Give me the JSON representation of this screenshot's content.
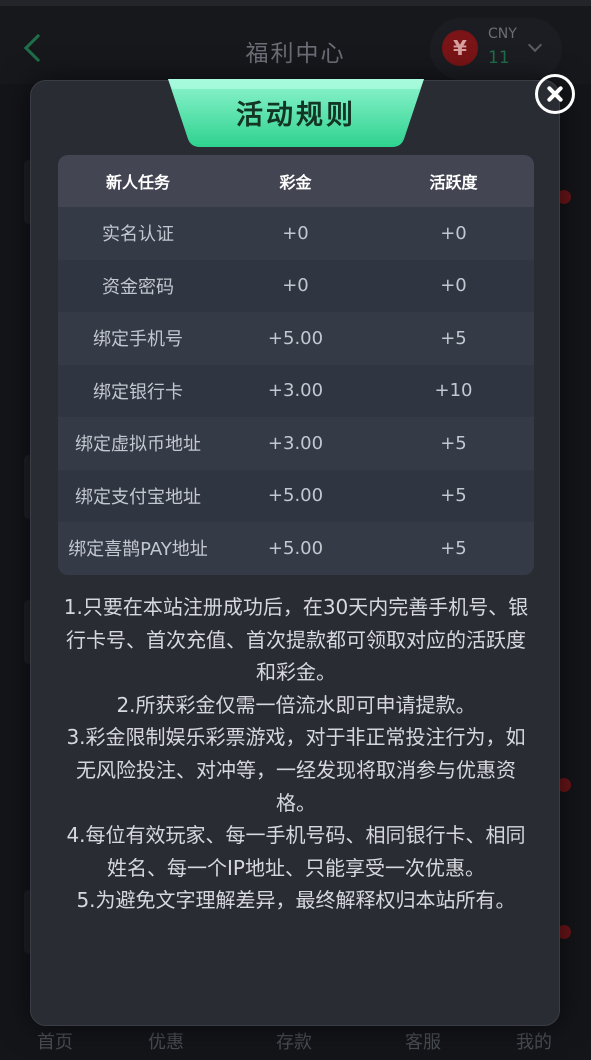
{
  "header": {
    "title": "福利中心",
    "currency_code": "CNY",
    "currency_amount": "11",
    "currency_symbol": "¥"
  },
  "modal": {
    "title": "活动规则",
    "table": {
      "headers": [
        "新人任务",
        "彩金",
        "活跃度"
      ],
      "rows": [
        [
          "实名认证",
          "+0",
          "+0"
        ],
        [
          "资金密码",
          "+0",
          "+0"
        ],
        [
          "绑定手机号",
          "+5.00",
          "+5"
        ],
        [
          "绑定银行卡",
          "+3.00",
          "+10"
        ],
        [
          "绑定虚拟币地址",
          "+3.00",
          "+5"
        ],
        [
          "绑定支付宝地址",
          "+5.00",
          "+5"
        ],
        [
          "绑定喜鹊PAY地址",
          "+5.00",
          "+5"
        ]
      ]
    },
    "rules": [
      "1.只要在本站注册成功后，在30天内完善手机号、银行卡号、首次充值、首次提款都可领取对应的活跃度和彩金。",
      "2.所获彩金仅需一倍流水即可申请提款。",
      "3.彩金限制娱乐彩票游戏，对于非正常投注行为，如无风险投注、对冲等，一经发现将取消参与优惠资格。",
      "4.每位有效玩家、每一手机号码、相同银行卡、相同姓名、每一个IP地址、只能享受一次优惠。",
      "5.为避免文字理解差异，最终解释权归本站所有。"
    ]
  },
  "tabbar": {
    "items": [
      "首页",
      "优惠",
      "存款",
      "客服",
      "我的"
    ]
  },
  "colors": {
    "accent_green": "#3fe0a0",
    "modal_bg": "#2a2c33",
    "table_head_bg": "#434652"
  }
}
